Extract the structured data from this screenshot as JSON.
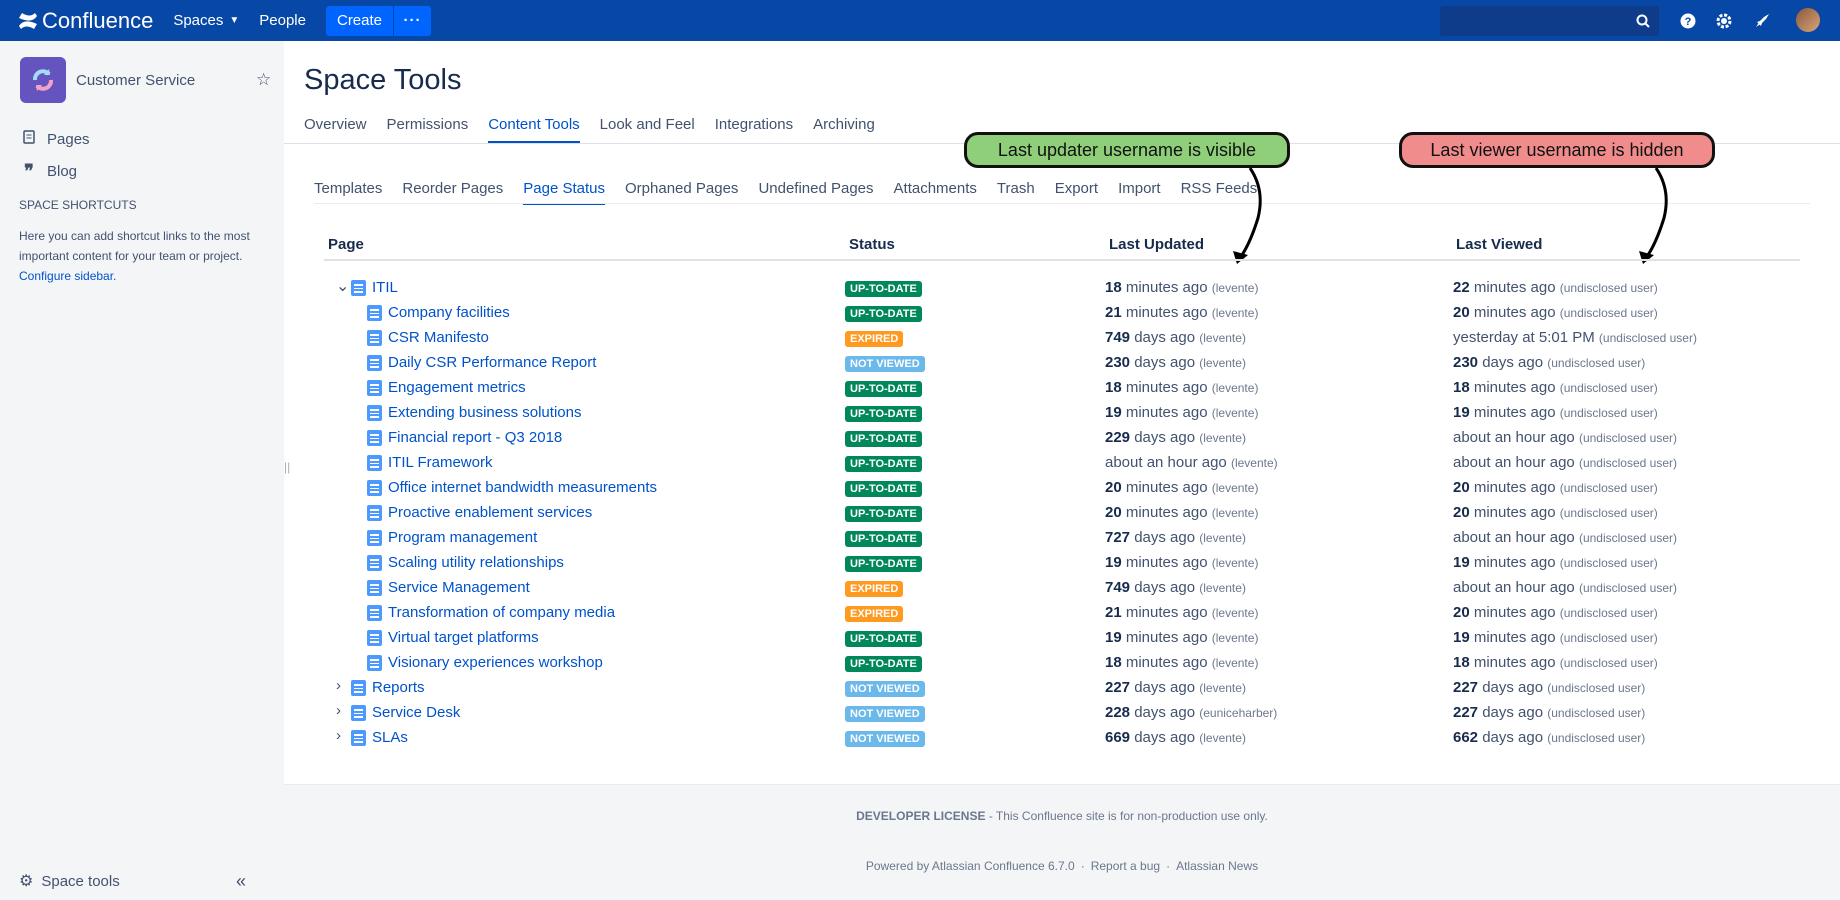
{
  "topbar": {
    "product": "Confluence",
    "spaces": "Spaces",
    "people": "People",
    "create": "Create"
  },
  "sidebar": {
    "space_name": "Customer Service",
    "items": [
      {
        "label": "Pages",
        "icon": "page-icon"
      },
      {
        "label": "Blog",
        "icon": "quote-icon"
      }
    ],
    "shortcuts_title": "SPACE SHORTCUTS",
    "shortcuts_text": "Here you can add shortcut links to the most important content for your team or project.",
    "configure_link": "Configure sidebar.",
    "space_tools": "Space tools"
  },
  "main": {
    "title": "Space Tools",
    "tabs": [
      "Overview",
      "Permissions",
      "Content Tools",
      "Look and Feel",
      "Integrations",
      "Archiving"
    ],
    "active_tab": "Content Tools",
    "subtabs": [
      "Templates",
      "Reorder Pages",
      "Page Status",
      "Orphaned Pages",
      "Undefined Pages",
      "Attachments",
      "Trash",
      "Export",
      "Import",
      "RSS Feeds"
    ],
    "active_subtab": "Page Status",
    "columns": {
      "page": "Page",
      "status": "Status",
      "updated": "Last Updated",
      "viewed": "Last Viewed"
    }
  },
  "callouts": {
    "updater": "Last updater username is visible",
    "viewer": "Last viewer username is hidden"
  },
  "status_colors": {
    "UP-TO-DATE": "#00875a",
    "EXPIRED": "#ff991f",
    "NOT VIEWED": "#6bb8ea"
  },
  "rows": [
    {
      "level": 0,
      "twisty": "expanded",
      "name": "ITIL",
      "status": "UP-TO-DATE",
      "upd_num": "18",
      "upd_text": " minutes ago",
      "upd_user": "(levente)",
      "view_num": "22",
      "view_text": " minutes ago",
      "view_user": "(undisclosed user)"
    },
    {
      "level": 1,
      "name": "Company facilities",
      "status": "UP-TO-DATE",
      "upd_num": "21",
      "upd_text": " minutes ago",
      "upd_user": "(levente)",
      "view_num": "20",
      "view_text": " minutes ago",
      "view_user": "(undisclosed user)"
    },
    {
      "level": 1,
      "name": "CSR Manifesto",
      "status": "EXPIRED",
      "upd_num": "749",
      "upd_text": " days ago",
      "upd_user": "(levente)",
      "view_num": "",
      "view_text": "yesterday at 5:01 PM",
      "view_user": "(undisclosed user)"
    },
    {
      "level": 1,
      "name": "Daily CSR Performance Report",
      "status": "NOT VIEWED",
      "upd_num": "230",
      "upd_text": " days ago",
      "upd_user": "(levente)",
      "view_num": "230",
      "view_text": " days ago",
      "view_user": "(undisclosed user)"
    },
    {
      "level": 1,
      "name": "Engagement metrics",
      "status": "UP-TO-DATE",
      "upd_num": "18",
      "upd_text": " minutes ago",
      "upd_user": "(levente)",
      "view_num": "18",
      "view_text": " minutes ago",
      "view_user": "(undisclosed user)"
    },
    {
      "level": 1,
      "name": "Extending business solutions",
      "status": "UP-TO-DATE",
      "upd_num": "19",
      "upd_text": " minutes ago",
      "upd_user": "(levente)",
      "view_num": "19",
      "view_text": " minutes ago",
      "view_user": "(undisclosed user)"
    },
    {
      "level": 1,
      "name": "Financial report - Q3 2018",
      "status": "UP-TO-DATE",
      "upd_num": "229",
      "upd_text": " days ago",
      "upd_user": "(levente)",
      "view_num": "",
      "view_text": "about an hour ago",
      "view_user": "(undisclosed user)"
    },
    {
      "level": 1,
      "name": "ITIL Framework",
      "status": "UP-TO-DATE",
      "upd_num": "",
      "upd_text": "about an hour ago",
      "upd_user": "(levente)",
      "view_num": "",
      "view_text": "about an hour ago",
      "view_user": "(undisclosed user)"
    },
    {
      "level": 1,
      "name": "Office internet bandwidth measurements",
      "status": "UP-TO-DATE",
      "upd_num": "20",
      "upd_text": " minutes ago",
      "upd_user": "(levente)",
      "view_num": "20",
      "view_text": " minutes ago",
      "view_user": "(undisclosed user)"
    },
    {
      "level": 1,
      "name": "Proactive enablement services",
      "status": "UP-TO-DATE",
      "upd_num": "20",
      "upd_text": " minutes ago",
      "upd_user": "(levente)",
      "view_num": "20",
      "view_text": " minutes ago",
      "view_user": "(undisclosed user)"
    },
    {
      "level": 1,
      "name": "Program management",
      "status": "UP-TO-DATE",
      "upd_num": "727",
      "upd_text": " days ago",
      "upd_user": "(levente)",
      "view_num": "",
      "view_text": "about an hour ago",
      "view_user": "(undisclosed user)"
    },
    {
      "level": 1,
      "name": "Scaling utility relationships",
      "status": "UP-TO-DATE",
      "upd_num": "19",
      "upd_text": " minutes ago",
      "upd_user": "(levente)",
      "view_num": "19",
      "view_text": " minutes ago",
      "view_user": "(undisclosed user)"
    },
    {
      "level": 1,
      "name": "Service Management",
      "status": "EXPIRED",
      "upd_num": "749",
      "upd_text": " days ago",
      "upd_user": "(levente)",
      "view_num": "",
      "view_text": "about an hour ago",
      "view_user": "(undisclosed user)"
    },
    {
      "level": 1,
      "name": "Transformation of company media",
      "status": "EXPIRED",
      "upd_num": "21",
      "upd_text": " minutes ago",
      "upd_user": "(levente)",
      "view_num": "20",
      "view_text": " minutes ago",
      "view_user": "(undisclosed user)"
    },
    {
      "level": 1,
      "name": "Virtual target platforms",
      "status": "UP-TO-DATE",
      "upd_num": "19",
      "upd_text": " minutes ago",
      "upd_user": "(levente)",
      "view_num": "19",
      "view_text": " minutes ago",
      "view_user": "(undisclosed user)"
    },
    {
      "level": 1,
      "name": "Visionary experiences workshop",
      "status": "UP-TO-DATE",
      "upd_num": "18",
      "upd_text": " minutes ago",
      "upd_user": "(levente)",
      "view_num": "18",
      "view_text": " minutes ago",
      "view_user": "(undisclosed user)"
    },
    {
      "level": 0,
      "twisty": "collapsed",
      "name": "Reports",
      "status": "NOT VIEWED",
      "upd_num": "227",
      "upd_text": " days ago",
      "upd_user": "(levente)",
      "view_num": "227",
      "view_text": " days ago",
      "view_user": "(undisclosed user)"
    },
    {
      "level": 0,
      "twisty": "collapsed",
      "name": "Service Desk",
      "status": "NOT VIEWED",
      "upd_num": "228",
      "upd_text": " days ago",
      "upd_user": "(euniceharber)",
      "view_num": "227",
      "view_text": " days ago",
      "view_user": "(undisclosed user)"
    },
    {
      "level": 0,
      "twisty": "collapsed",
      "name": "SLAs",
      "status": "NOT VIEWED",
      "upd_num": "669",
      "upd_text": " days ago",
      "upd_user": "(levente)",
      "view_num": "662",
      "view_text": " days ago",
      "view_user": "(undisclosed user)"
    }
  ],
  "footer": {
    "license_bold": "DEVELOPER LICENSE",
    "license_text": " - This Confluence site is for non-production use only.",
    "powered": "Powered by Atlassian Confluence 6.7.0",
    "report": "Report a bug",
    "news": "Atlassian News"
  }
}
